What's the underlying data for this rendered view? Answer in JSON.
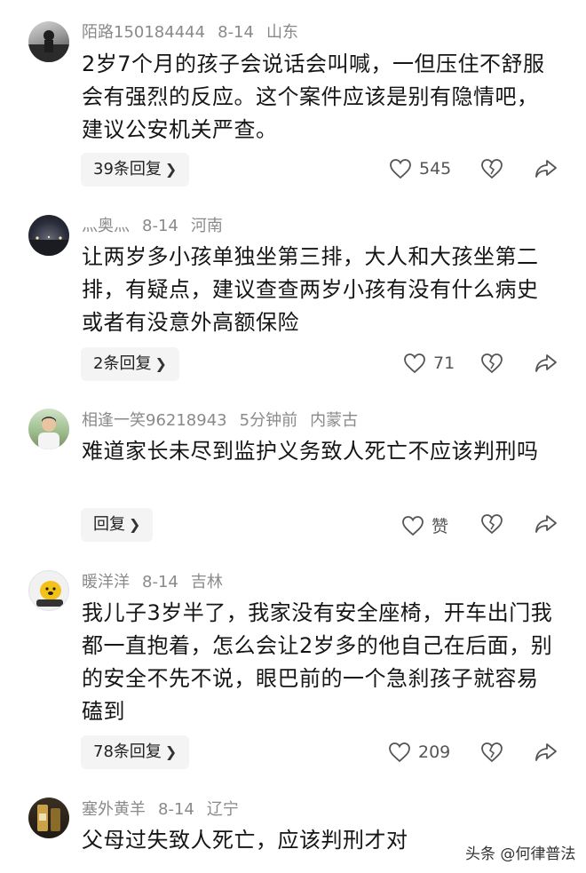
{
  "comments": [
    {
      "username": "陌路150184444",
      "date": "8-14",
      "location": "山东",
      "text": "2岁7个月的孩子会说话会叫喊，一但压住不舒服会有强烈的反应。这个案件应该是别有隐情吧，建议公安机关严查。",
      "reply_label": "39条回复",
      "like_count": "545"
    },
    {
      "username": "灬奥灬",
      "date": "8-14",
      "location": "河南",
      "text": "让两岁多小孩单独坐第三排，大人和大孩坐第二排，有疑点，建议查查两岁小孩有没有什么病史或者有没意外高额保险",
      "reply_label": "2条回复",
      "like_count": "71"
    },
    {
      "username": "相逢一笑96218943",
      "date": "5分钟前",
      "location": "内蒙古",
      "text": "难道家长未尽到监护义务致人死亡不应该判刑吗",
      "reply_label": "回复",
      "like_count": "赞"
    },
    {
      "username": "暖洋洋",
      "date": "8-14",
      "location": "吉林",
      "text": "我儿子3岁半了，我家没有安全座椅，开车出门我都一直抱着，怎么会让2岁多的他自己在后面，别的安全不先不说，眼巴前的一个急刹孩子就容易磕到",
      "reply_label": "78条回复",
      "like_count": "209"
    },
    {
      "username": "塞外黄羊",
      "date": "8-14",
      "location": "辽宁",
      "text": "父母过失致人死亡，应该判刑才对"
    }
  ],
  "icons": {
    "like": "heart-icon",
    "dislike": "broken-heart-icon",
    "share": "share-arrow-icon",
    "reply_chevron": "chevron-right-icon"
  },
  "watermark": "头条 @何律普法",
  "colors": {
    "meta_text": "#8a8a8a",
    "body_text": "#161616",
    "reply_bg": "#f4f4f4",
    "icon": "#555555"
  }
}
